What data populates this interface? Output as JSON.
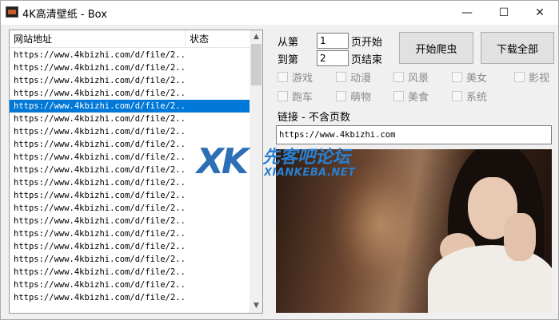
{
  "window": {
    "title": "4K高清壁纸 - Box",
    "controls": {
      "minimize": "—",
      "maximize": "☐",
      "close": "✕"
    }
  },
  "list": {
    "columns": {
      "url": "网站地址",
      "status": "状态"
    },
    "selected_index": 4,
    "rows": [
      {
        "url": "https://www.4kbizhi.com/d/file/2...",
        "status": ""
      },
      {
        "url": "https://www.4kbizhi.com/d/file/2...",
        "status": ""
      },
      {
        "url": "https://www.4kbizhi.com/d/file/2...",
        "status": ""
      },
      {
        "url": "https://www.4kbizhi.com/d/file/2...",
        "status": ""
      },
      {
        "url": "https://www.4kbizhi.com/d/file/2...",
        "status": ""
      },
      {
        "url": "https://www.4kbizhi.com/d/file/2...",
        "status": ""
      },
      {
        "url": "https://www.4kbizhi.com/d/file/2...",
        "status": ""
      },
      {
        "url": "https://www.4kbizhi.com/d/file/2...",
        "status": ""
      },
      {
        "url": "https://www.4kbizhi.com/d/file/2...",
        "status": ""
      },
      {
        "url": "https://www.4kbizhi.com/d/file/2...",
        "status": ""
      },
      {
        "url": "https://www.4kbizhi.com/d/file/2...",
        "status": ""
      },
      {
        "url": "https://www.4kbizhi.com/d/file/2...",
        "status": ""
      },
      {
        "url": "https://www.4kbizhi.com/d/file/2...",
        "status": ""
      },
      {
        "url": "https://www.4kbizhi.com/d/file/2...",
        "status": ""
      },
      {
        "url": "https://www.4kbizhi.com/d/file/2...",
        "status": ""
      },
      {
        "url": "https://www.4kbizhi.com/d/file/2...",
        "status": ""
      },
      {
        "url": "https://www.4kbizhi.com/d/file/2...",
        "status": ""
      },
      {
        "url": "https://www.4kbizhi.com/d/file/2...",
        "status": ""
      },
      {
        "url": "https://www.4kbizhi.com/d/file/2...",
        "status": ""
      },
      {
        "url": "https://www.4kbizhi.com/d/file/2...",
        "status": ""
      }
    ]
  },
  "range": {
    "from_label": "从第",
    "from_value": "1",
    "from_suffix": "页开始",
    "to_label": "到第",
    "to_value": "2",
    "to_suffix": "页结束"
  },
  "buttons": {
    "start": "开始爬虫",
    "download_all": "下载全部"
  },
  "categories": {
    "row1": [
      "游戏",
      "动漫",
      "风景",
      "美女",
      "影视"
    ],
    "row2": [
      "跑车",
      "萌物",
      "美食",
      "系统"
    ]
  },
  "link": {
    "label": "链接 - 不含页数",
    "value": "https://www.4kbizhi.com"
  },
  "watermark": {
    "logo": "XK",
    "cn": "先客吧论坛",
    "en": "XIANKEBA.NET"
  }
}
